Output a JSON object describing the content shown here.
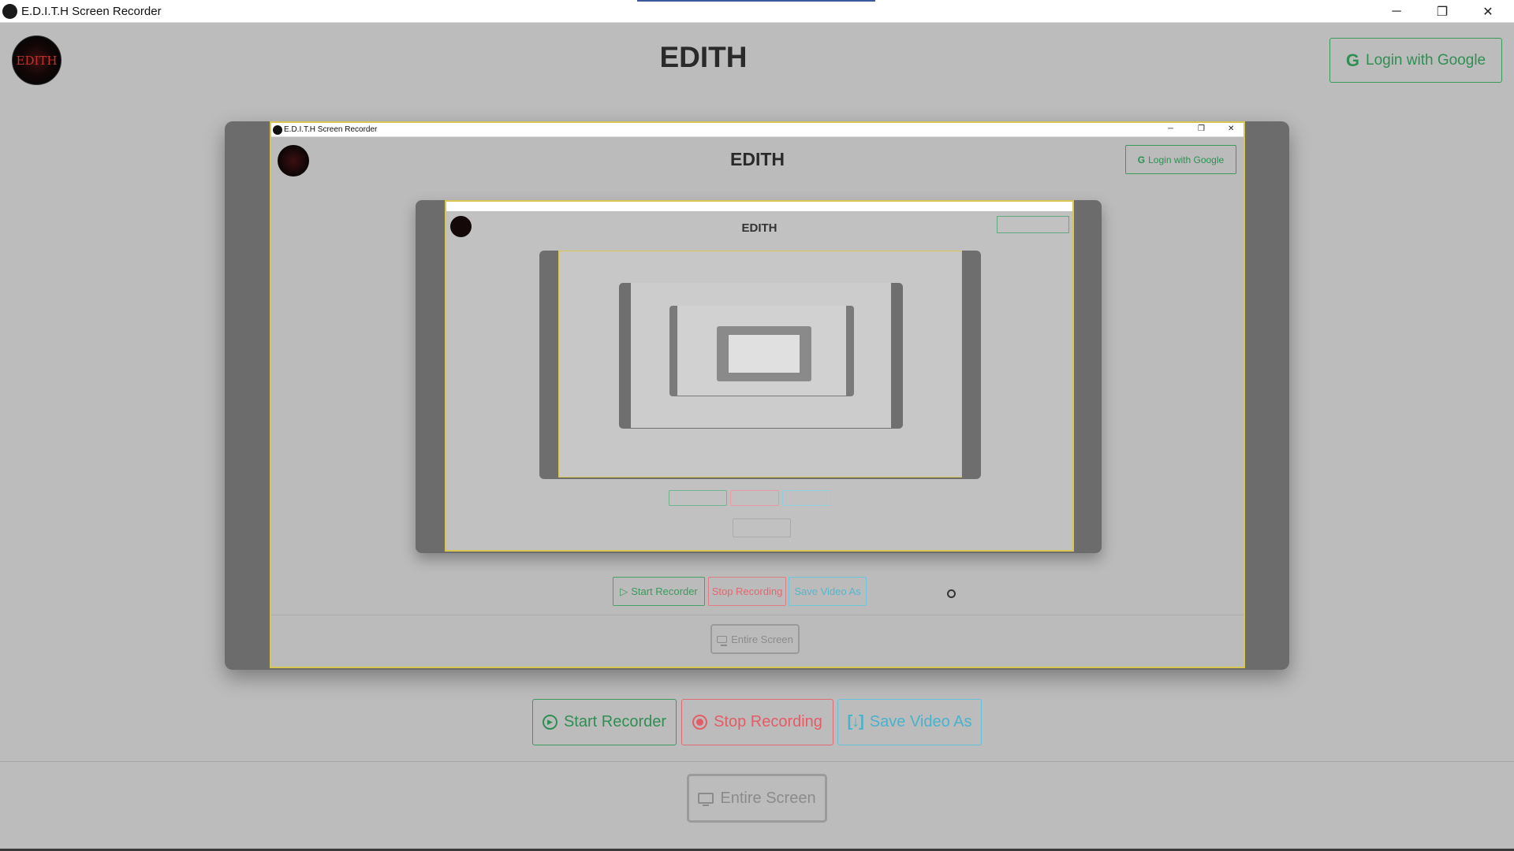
{
  "window": {
    "title": "E.D.I.T.H Screen Recorder",
    "minimize_glyph": "─",
    "maximize_glyph": "❐",
    "close_glyph": "✕"
  },
  "header": {
    "logo_text": "EDITH",
    "title": "EDITH",
    "login_label": "Login with Google",
    "login_icon": "G"
  },
  "preview": {
    "window_title": "E.D.I.T.H Screen Recorder",
    "app_title": "EDITH",
    "login_label": "Login with Google",
    "login_icon": "G",
    "level2_title": "EDITH",
    "start_label": "Start Recorder",
    "stop_label": "Stop Recording",
    "save_label": "Save Video As",
    "entire_label": "Entire Screen"
  },
  "controls": {
    "start_label": "Start Recorder",
    "stop_label": "Stop Recording",
    "save_label": "Save Video As",
    "save_icon_text": "[↓]",
    "entire_label": "Entire Screen"
  },
  "colors": {
    "green": "#2f8f52",
    "red": "#e35c66",
    "cyan": "#49b2cc",
    "frame_border": "#d9c652"
  }
}
